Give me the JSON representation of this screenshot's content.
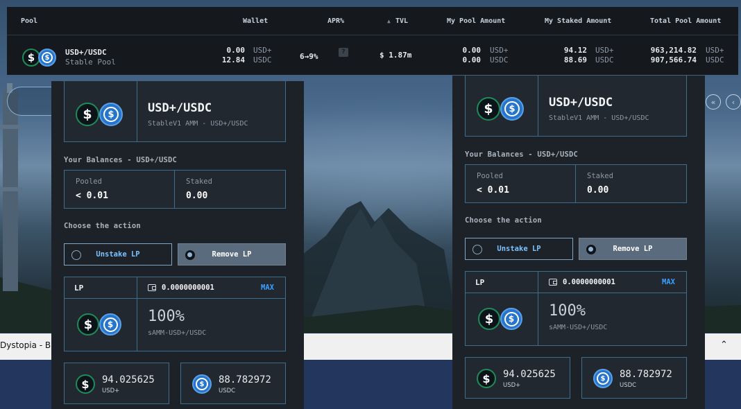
{
  "table": {
    "headers": {
      "pool": "Pool",
      "wallet": "Wallet",
      "apr": "APR%",
      "tvl": "TVL",
      "my_pool": "My Pool Amount",
      "my_staked": "My Staked Amount",
      "total_pool": "Total Pool Amount"
    },
    "row": {
      "name": "USD+/USDC",
      "type": "Stable Pool",
      "wallet": [
        {
          "value": "0.00",
          "token": "USD+"
        },
        {
          "value": "12.84",
          "token": "USDC"
        }
      ],
      "apr": "6→9%",
      "tvl": "$ 1.87m",
      "my_pool": [
        {
          "value": "0.00",
          "token": "USD+"
        },
        {
          "value": "0.00",
          "token": "USDC"
        }
      ],
      "my_staked": [
        {
          "value": "94.12",
          "token": "USD+"
        },
        {
          "value": "88.69",
          "token": "USDC"
        }
      ],
      "total_pool": [
        {
          "value": "963,214.82",
          "token": "USD+"
        },
        {
          "value": "907,566.74",
          "token": "USDC"
        }
      ]
    }
  },
  "taskbar": {
    "label": "Dystopia - Brav",
    "right_glyph": "⌃"
  },
  "panel_left": {
    "pair": "USD+/USDC",
    "pair_sub": "StableV1 AMM - USD+/USDC",
    "balances_title": "Your Balances - USD+/USDC",
    "pooled_label": "Pooled",
    "pooled_value": "< 0.01",
    "staked_label": "Staked",
    "staked_value": "0.00",
    "action_title": "Choose the action",
    "unstake_label": "Unstake LP",
    "remove_label": "Remove LP",
    "lp_label": "LP",
    "lp_amount": "0.0000000001",
    "max_label": "MAX",
    "percent": "100%",
    "lp_token": "sAMM-USD+/USDC",
    "out1_value": "94.025625",
    "out1_symbol": "USD+",
    "out2_value": "88.782972",
    "out2_symbol": "USDC"
  },
  "panel_right": {
    "pair": "USD+/USDC",
    "pair_sub": "StableV1 AMM - USD+/USDC",
    "balances_title": "Your Balances - USD+/USDC",
    "pooled_label": "Pooled",
    "pooled_value": "< 0.01",
    "staked_label": "Staked",
    "staked_value": "0.00",
    "action_title": "Choose the action",
    "unstake_label": "Unstake LP",
    "remove_label": "Remove LP",
    "lp_label": "LP",
    "lp_amount": "0.0000000001",
    "max_label": "MAX",
    "percent": "100%",
    "lp_token": "sAMM-USD+/USDC",
    "out1_value": "94.025625",
    "out1_symbol": "USD+",
    "out2_value": "88.782972",
    "out2_symbol": "USDC"
  },
  "icons": {
    "usd_plus": "usd-plus-coin-icon",
    "usdc": "usdc-coin-icon",
    "wallet": "wallet-icon",
    "apr_info": "apr-info-icon",
    "sort": "sort-arrow-icon",
    "first_page": "double-chevron-left-icon",
    "prev_page": "chevron-left-icon"
  },
  "colors": {
    "accent_blue": "#3aa0ff",
    "border_blue": "#3e6e8e",
    "panel_bg": "#1d2228",
    "table_bg": "#15181d",
    "usdc_blue": "#2775ca",
    "usd_plus_green": "#1e8c5a"
  }
}
